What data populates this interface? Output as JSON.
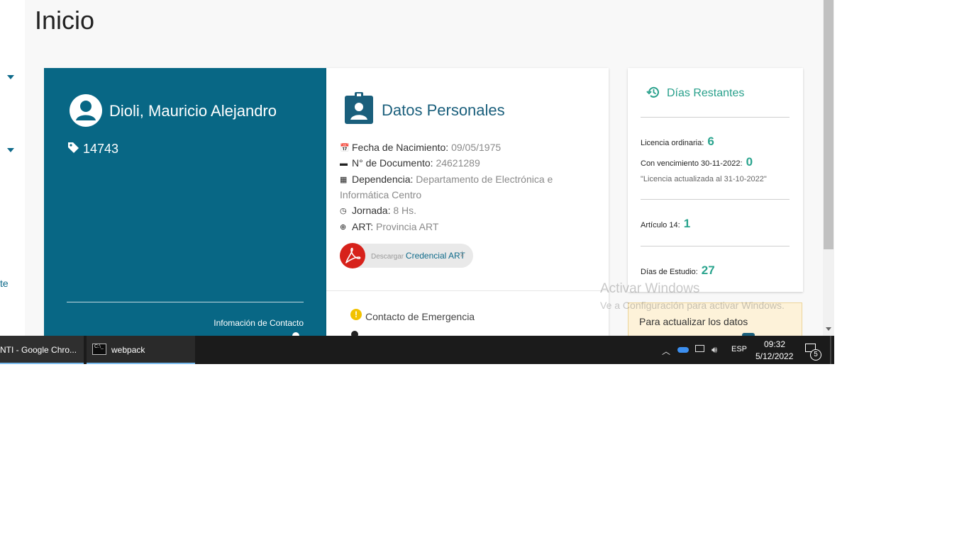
{
  "page": {
    "title": "Inicio"
  },
  "sidebar": {
    "partial_text": "te",
    "colors": {
      "accent": "#0e6a8a"
    }
  },
  "profile": {
    "name": "Dioli, Mauricio Alejandro",
    "legajo": "14743",
    "contact_label": "Infomación de Contacto",
    "color": "#086785"
  },
  "personal": {
    "title": "Datos Personales",
    "fields": {
      "birth": {
        "icon": "calendar-icon",
        "label": "Fecha de Nacimiento:",
        "value": "09/05/1975"
      },
      "doc": {
        "icon": "card-icon",
        "label": "N° de Documento:",
        "value": "24621289"
      },
      "dependency": {
        "icon": "building-icon",
        "label": "Dependencia:",
        "value": "Departamento de Electrónica e Informática Centro"
      },
      "schedule": {
        "icon": "clock-icon",
        "label": "Jornada:",
        "value": "8 Hs."
      },
      "art": {
        "icon": "plus-circle-icon",
        "label": "ART:",
        "value": "Provincia ART"
      }
    },
    "download": {
      "prefix": "Descargar",
      "link": "Credencial ART"
    },
    "emergency": "Contacto de Emergencia"
  },
  "days": {
    "title": "Días Restantes",
    "ordinary": {
      "label": "Licencia ordinaria:",
      "value": "6"
    },
    "expiring": {
      "label": "Con vencimiento 30-11-2022:",
      "value": "0"
    },
    "note": "\"Licencia actualizada al 31-10-2022\"",
    "article": {
      "label": "Artículo 14:",
      "value": "1"
    },
    "study": {
      "label": "Días de Estudio:",
      "value": "27"
    },
    "accent": "#2aa48e"
  },
  "notice": {
    "text": "Para actualizar los datos"
  },
  "watermark": {
    "line1": "Activar Windows",
    "line2": "Ve a Configuración para activar Windows."
  },
  "taskbar": {
    "chrome": "NTI - Google Chro...",
    "webpack": "webpack",
    "language": "ESP",
    "time": "09:32",
    "date": "5/12/2022",
    "notifications": "5"
  }
}
